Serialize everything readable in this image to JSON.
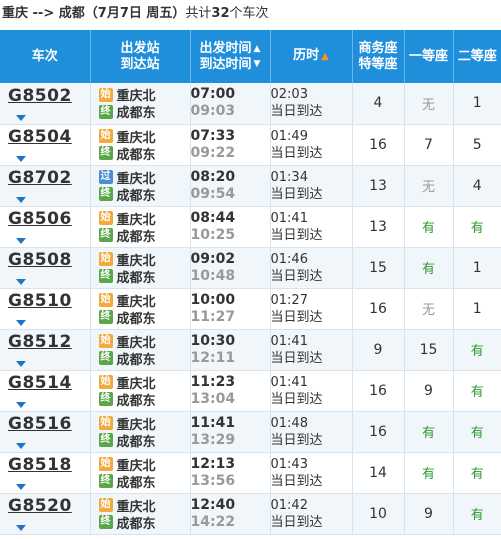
{
  "route": {
    "from": "重庆",
    "arrow": " --> ",
    "to": "成都",
    "date": "（7月7日  周五）",
    "count_prefix": "共计",
    "count": "32",
    "count_suffix": "个车次"
  },
  "header": {
    "col_code": "车次",
    "col_station_line1": "出发站",
    "col_station_line2": "到达站",
    "col_time_line1": "出发时间",
    "col_time_line2": "到达时间",
    "col_duration": "历时",
    "col_business_line1": "商务座",
    "col_business_line2": "特等座",
    "col_first": "一等座",
    "col_second": "二等座"
  },
  "badges": {
    "start": "始",
    "end": "终",
    "pass": "过"
  },
  "trains": [
    {
      "code": "G8502",
      "from": "重庆北",
      "from_type": "start",
      "to": "成都东",
      "to_type": "end",
      "dep": "07:00",
      "arr": "09:03",
      "dur": "02:03",
      "day": "当日到达",
      "business": "4",
      "first": "无",
      "second": "1"
    },
    {
      "code": "G8504",
      "from": "重庆北",
      "from_type": "start",
      "to": "成都东",
      "to_type": "end",
      "dep": "07:33",
      "arr": "09:22",
      "dur": "01:49",
      "day": "当日到达",
      "business": "16",
      "first": "7",
      "second": "5"
    },
    {
      "code": "G8702",
      "from": "重庆北",
      "from_type": "pass",
      "to": "成都东",
      "to_type": "end",
      "dep": "08:20",
      "arr": "09:54",
      "dur": "01:34",
      "day": "当日到达",
      "business": "13",
      "first": "无",
      "second": "4"
    },
    {
      "code": "G8506",
      "from": "重庆北",
      "from_type": "start",
      "to": "成都东",
      "to_type": "end",
      "dep": "08:44",
      "arr": "10:25",
      "dur": "01:41",
      "day": "当日到达",
      "business": "13",
      "first": "有",
      "second": "有"
    },
    {
      "code": "G8508",
      "from": "重庆北",
      "from_type": "start",
      "to": "成都东",
      "to_type": "end",
      "dep": "09:02",
      "arr": "10:48",
      "dur": "01:46",
      "day": "当日到达",
      "business": "15",
      "first": "有",
      "second": "1"
    },
    {
      "code": "G8510",
      "from": "重庆北",
      "from_type": "start",
      "to": "成都东",
      "to_type": "end",
      "dep": "10:00",
      "arr": "11:27",
      "dur": "01:27",
      "day": "当日到达",
      "business": "16",
      "first": "无",
      "second": "1"
    },
    {
      "code": "G8512",
      "from": "重庆北",
      "from_type": "start",
      "to": "成都东",
      "to_type": "end",
      "dep": "10:30",
      "arr": "12:11",
      "dur": "01:41",
      "day": "当日到达",
      "business": "9",
      "first": "15",
      "second": "有"
    },
    {
      "code": "G8514",
      "from": "重庆北",
      "from_type": "start",
      "to": "成都东",
      "to_type": "end",
      "dep": "11:23",
      "arr": "13:04",
      "dur": "01:41",
      "day": "当日到达",
      "business": "16",
      "first": "9",
      "second": "有"
    },
    {
      "code": "G8516",
      "from": "重庆北",
      "from_type": "start",
      "to": "成都东",
      "to_type": "end",
      "dep": "11:41",
      "arr": "13:29",
      "dur": "01:48",
      "day": "当日到达",
      "business": "16",
      "first": "有",
      "second": "有"
    },
    {
      "code": "G8518",
      "from": "重庆北",
      "from_type": "start",
      "to": "成都东",
      "to_type": "end",
      "dep": "12:13",
      "arr": "13:56",
      "dur": "01:43",
      "day": "当日到达",
      "business": "14",
      "first": "有",
      "second": "有"
    },
    {
      "code": "G8520",
      "from": "重庆北",
      "from_type": "start",
      "to": "成都东",
      "to_type": "end",
      "dep": "12:40",
      "arr": "14:22",
      "dur": "01:42",
      "day": "当日到达",
      "business": "10",
      "first": "9",
      "second": "有"
    }
  ],
  "colors": {
    "header_bg": "#1f8fdc",
    "available": "#2d9a2d",
    "unavailable": "#999999",
    "dropdown_arrow": "#1f75c6"
  }
}
